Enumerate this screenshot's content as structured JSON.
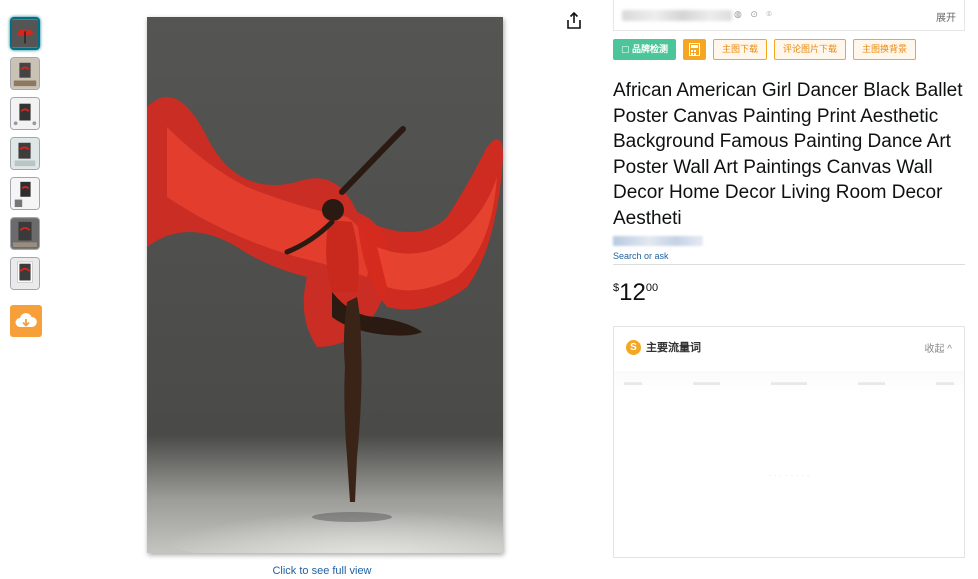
{
  "thumbnails": [
    "thumb-1",
    "thumb-2",
    "thumb-3",
    "thumb-4",
    "thumb-5",
    "thumb-6",
    "thumb-7"
  ],
  "main_image": {
    "full_view_text": "Click to see full view"
  },
  "seller_bar": {
    "expand_label": "展开"
  },
  "toolbar": {
    "brand_check": "▢ 品牌检测",
    "calc_icon": "calculator-icon",
    "main_image_download": "主图下载",
    "review_image_download": "评论图片下载",
    "main_image_bg_swap": "主图换背景"
  },
  "product": {
    "title": "African American Girl Dancer Black Ballet Poster Canvas Painting Print Aesthetic Background Famous Painting Dance Art Poster Wall Art Paintings Canvas Wall Decor Home Decor Living Room Decor Aestheti",
    "search_ask": "Search or ask",
    "price_symbol": "$",
    "price_whole": "12",
    "price_fraction": "00"
  },
  "traffic_panel": {
    "icon_letter": "S",
    "title": "主要流量词",
    "collapse_label": "收起 ^"
  },
  "colors": {
    "link": "#2162a1",
    "accent_orange": "#f5a623",
    "brand_green": "#4cc59a"
  }
}
